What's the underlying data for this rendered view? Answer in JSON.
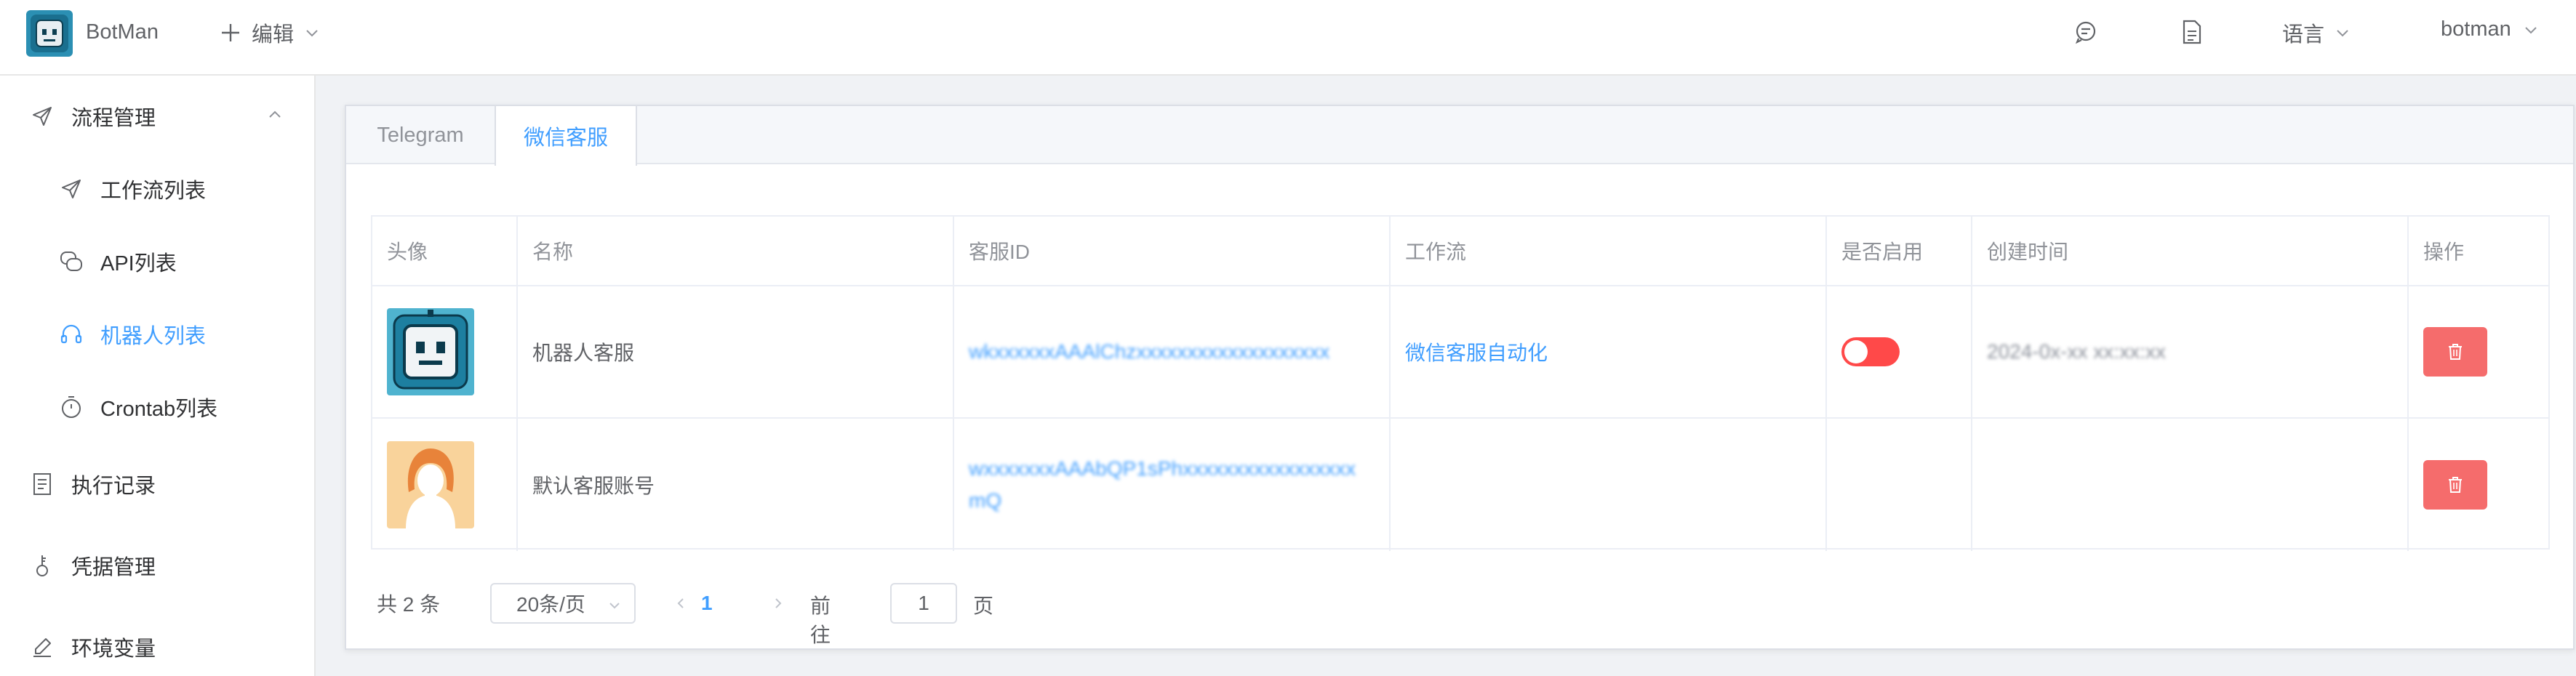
{
  "header": {
    "brand": "BotMan",
    "edit_label": "编辑",
    "language_label": "语言",
    "user_label": "botman"
  },
  "sidebar": {
    "items": [
      {
        "label": "流程管理",
        "icon": "send-icon"
      },
      {
        "label": "工作流列表",
        "icon": "send-icon"
      },
      {
        "label": "API列表",
        "icon": "chat-icon"
      },
      {
        "label": "机器人列表",
        "icon": "headset-icon"
      },
      {
        "label": "Crontab列表",
        "icon": "stopwatch-icon"
      },
      {
        "label": "执行记录",
        "icon": "document-icon"
      },
      {
        "label": "凭据管理",
        "icon": "key-icon"
      },
      {
        "label": "环境变量",
        "icon": "pen-icon"
      }
    ],
    "active": "机器人列表"
  },
  "tabs": [
    {
      "label": "Telegram",
      "active": false
    },
    {
      "label": "微信客服",
      "active": true
    }
  ],
  "table": {
    "columns": [
      "头像",
      "名称",
      "客服ID",
      "工作流",
      "是否启用",
      "创建时间",
      "操作"
    ],
    "rows": [
      {
        "avatar": "robot-avatar",
        "name": "机器人客服",
        "id": "wkxxxxxxAAAlChzxxxxxxxxxxxxxxxxxxx",
        "workflow": "微信客服自动化",
        "enabled": false,
        "created": "2024-0x-xx xx:xx:xx"
      },
      {
        "avatar": "woman-avatar",
        "name": "默认客服账号",
        "id": "wxxxxxxxAAAbQP1sPhxxxxxxxxxxxxxxxxxmQ",
        "workflow": "",
        "enabled": null,
        "created": ""
      }
    ]
  },
  "pagination": {
    "total_text": "共 2 条",
    "page_size": "20条/页",
    "current_page": "1",
    "goto_label": "前往",
    "goto_value": "1",
    "goto_unit": "页"
  },
  "colors": {
    "accent": "#409eff",
    "danger": "#f56c6c",
    "switch_off": "#ff4949"
  }
}
